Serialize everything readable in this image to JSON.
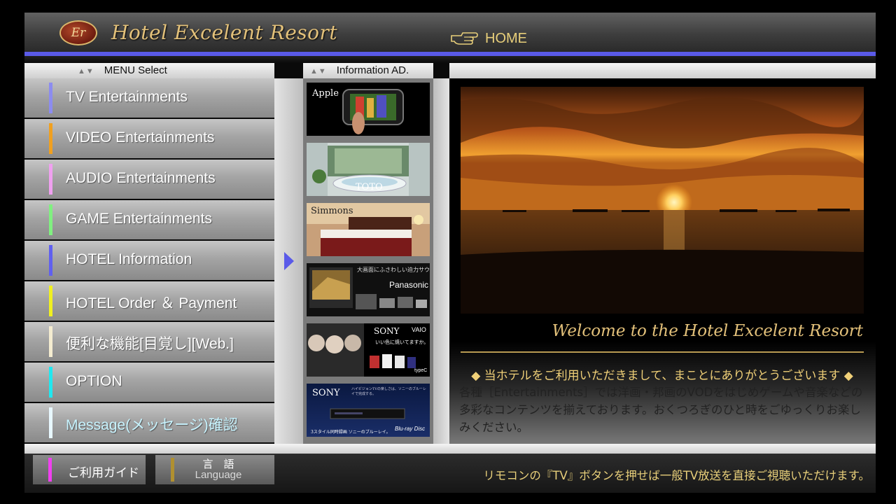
{
  "header": {
    "logo_text": "Er",
    "hotel_name": "Hotel Excelent Resort",
    "home_label": "HOME"
  },
  "menu": {
    "heading": "MENU Select",
    "items": [
      {
        "label": "TV Entertainments",
        "color": "#8c8cf0"
      },
      {
        "label": "VIDEO Entertainments",
        "color": "#f0a020"
      },
      {
        "label": "AUDIO Entertainments",
        "color": "#f0a0f0"
      },
      {
        "label": "GAME Entertainments",
        "color": "#80f080"
      },
      {
        "label": "HOTEL Information",
        "color": "#6060f0"
      },
      {
        "label": "HOTEL Order ＆ Payment",
        "color": "#f0f020"
      },
      {
        "label": "便利な機能[目覚し][Web.]",
        "color": "#f4ecd0"
      },
      {
        "label": "OPTION",
        "color": "#20e8f0"
      },
      {
        "label": "Message(メッセージ)確認",
        "color": "#e8f8ff",
        "label_color": "#c8f4ff"
      }
    ]
  },
  "ads": {
    "heading": "Information AD.",
    "items": [
      {
        "brand": "Apple"
      },
      {
        "brand": "TOTO"
      },
      {
        "brand": "Simmons"
      },
      {
        "brand": "Panasonic",
        "caption": "大画面にふさわしい迫力サウンド"
      },
      {
        "brand": "SONY",
        "sub": "VAIO",
        "caption": "いい色に焼いてますか。",
        "tag": "typeC"
      },
      {
        "brand": "SONY",
        "caption": "ハイビジョンTVの楽しさは、ソニーのブルーレイで完成する。",
        "tagline": "3スタイル同時録画 ソニーのブルーレイ。",
        "logo": "Blu-ray Disc"
      }
    ]
  },
  "main": {
    "welcome": "Welcome to the Hotel Excelent Resort",
    "greeting": "◆ 当ホテルをご利用いただきまして、まことにありがとうございます ◆",
    "description": "各種［Entertainments］では洋画・邦画のVODをはじめゲームや音楽などの多彩なコンテンツを揃えております。おくつろぎのひと時をごゆっくりお楽しみください。"
  },
  "footer": {
    "guide_label": "ご利用ガイド",
    "guide_color": "#f040f0",
    "lang_label_jp": "言　語",
    "lang_label_en": "Language",
    "lang_color": "#b09030",
    "note": "リモコンの『TV』ボタンを押せば一般TV放送を直接ご視聴いただけます。"
  }
}
